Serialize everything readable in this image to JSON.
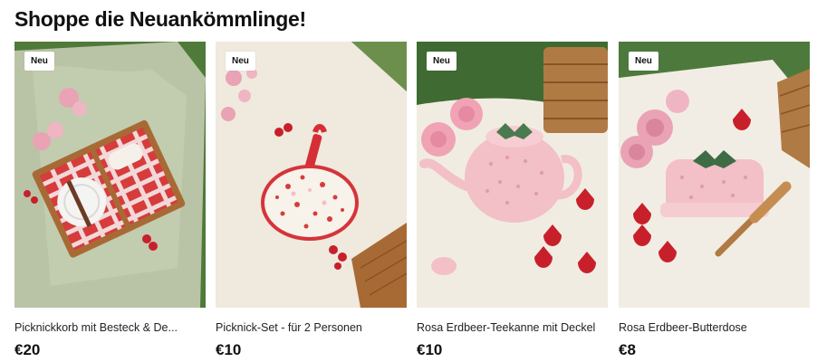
{
  "section": {
    "title": "Shoppe die Neuankömmlinge!"
  },
  "products": [
    {
      "name": "Picknickkorb mit Besteck & De...",
      "price": "€20",
      "badge": "Neu",
      "image_icon": "picnic-basket-icon"
    },
    {
      "name": "Picknick-Set - für 2 Personen",
      "price": "€10",
      "badge": "Neu",
      "image_icon": "picnic-set-icon"
    },
    {
      "name": "Rosa Erdbeer-Teekanne mit Deckel",
      "price": "€10",
      "badge": "Neu",
      "image_icon": "teapot-icon"
    },
    {
      "name": "Rosa Erdbeer-Butterdose",
      "price": "€8",
      "badge": "Neu",
      "image_icon": "butter-dish-icon"
    }
  ],
  "colors": {
    "grass": "#4f7a3a",
    "blanket_sage": "#b9c4a6",
    "blanket_cream": "#efe9de",
    "gingham_red": "#d63c3c",
    "pastel_pink": "#f2c0c6",
    "wicker": "#b07a44",
    "strawberry": "#c8202b",
    "peony": "#e9a3b5"
  }
}
